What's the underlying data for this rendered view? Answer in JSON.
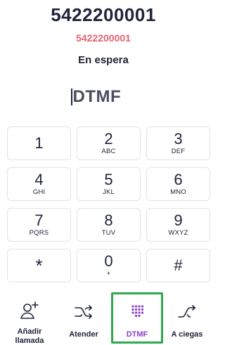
{
  "call": {
    "number": "5422200001",
    "subnumber": "5422200001",
    "status": "En espera"
  },
  "dtmf": {
    "placeholder": "DTMF",
    "value": ""
  },
  "keypad": {
    "keys": [
      {
        "digit": "1",
        "letters": ""
      },
      {
        "digit": "2",
        "letters": "ABC"
      },
      {
        "digit": "3",
        "letters": "DEF"
      },
      {
        "digit": "4",
        "letters": "GHI"
      },
      {
        "digit": "5",
        "letters": "JKL"
      },
      {
        "digit": "6",
        "letters": "MNO"
      },
      {
        "digit": "7",
        "letters": "PQRS"
      },
      {
        "digit": "8",
        "letters": "TUV"
      },
      {
        "digit": "9",
        "letters": "WXYZ"
      },
      {
        "digit": "*",
        "letters": ""
      },
      {
        "digit": "0",
        "letters": "+"
      },
      {
        "digit": "#",
        "letters": ""
      }
    ]
  },
  "actions": {
    "add_call": {
      "label_line1": "Añadir",
      "label_line2": "llamada",
      "icon": "add-user-icon"
    },
    "attend": {
      "label": "Atender",
      "icon": "shuffle-icon"
    },
    "dtmf": {
      "label": "DTMF",
      "icon": "keypad-dots-icon",
      "active": true
    },
    "blind": {
      "label": "A ciegas",
      "icon": "blind-transfer-icon"
    }
  },
  "colors": {
    "accent_red": "#e06371",
    "accent_purple": "#8b3fc7",
    "highlight_green": "#2fa84f",
    "text_dark": "#20243a"
  }
}
